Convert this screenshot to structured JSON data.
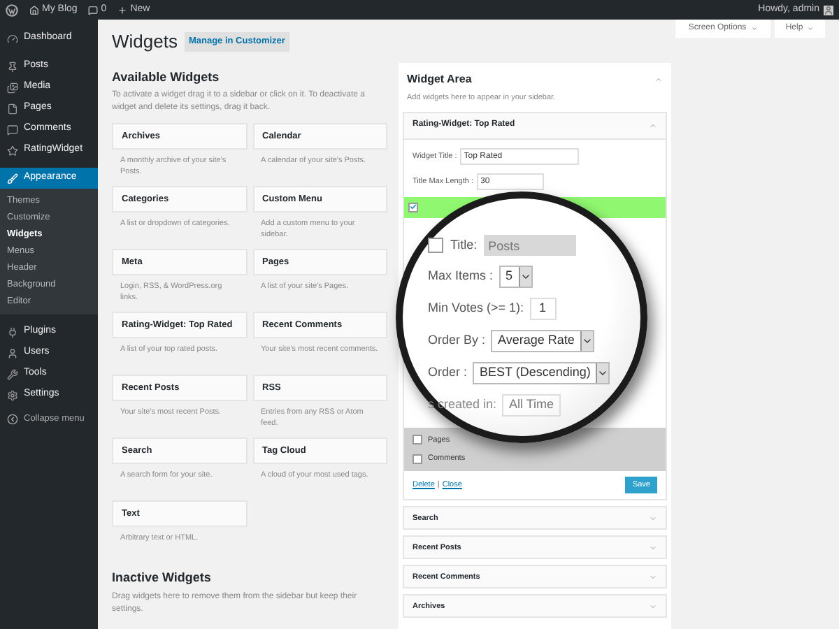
{
  "admin_bar": {
    "site": "My Blog",
    "comments": "0",
    "new": "New",
    "greeting": "Howdy, admin"
  },
  "sidebar": {
    "items": [
      {
        "label": "Dashboard",
        "selected": false
      },
      {
        "label": "Posts",
        "selected": false
      },
      {
        "label": "Media",
        "selected": false
      },
      {
        "label": "Pages",
        "selected": false
      },
      {
        "label": "Comments",
        "selected": false
      },
      {
        "label": "RatingWidget",
        "selected": false
      },
      {
        "label": "Appearance",
        "selected": true,
        "children": [
          {
            "label": "Themes",
            "selected": false
          },
          {
            "label": "Customize",
            "selected": false
          },
          {
            "label": "Widgets",
            "selected": true
          },
          {
            "label": "Menus",
            "selected": false
          },
          {
            "label": "Header",
            "selected": false
          },
          {
            "label": "Background",
            "selected": false
          },
          {
            "label": "Editor",
            "selected": false
          }
        ]
      },
      {
        "label": "Plugins",
        "selected": false
      },
      {
        "label": "Users",
        "selected": false
      },
      {
        "label": "Tools",
        "selected": false
      },
      {
        "label": "Settings",
        "selected": false
      }
    ],
    "collapse": "Collapse menu"
  },
  "page": {
    "title": "Widgets",
    "customizer_button": "Manage in Customizer",
    "screen_options": "Screen Options",
    "help": "Help"
  },
  "available": {
    "title": "Available Widgets",
    "description": "To activate a widget drag it to a sidebar or click on it. To deactivate a widget and delete its settings, drag it back.",
    "widgets": [
      {
        "title": "Archives",
        "description": "A monthly archive of your site's Posts."
      },
      {
        "title": "Calendar",
        "description": "A calendar of your site's Posts."
      },
      {
        "title": "Categories",
        "description": "A list or dropdown of categories."
      },
      {
        "title": "Custom Menu",
        "description": "Add a custom menu to your sidebar."
      },
      {
        "title": "Meta",
        "description": "Login, RSS, & WordPress.org links."
      },
      {
        "title": "Pages",
        "description": "A list of your site's Pages."
      },
      {
        "title": "Rating-Widget: Top Rated",
        "description": "A list of your top rated posts."
      },
      {
        "title": "Recent Comments",
        "description": "Your site's most recent comments."
      },
      {
        "title": "Recent Posts",
        "description": "Your site's most recent Posts."
      },
      {
        "title": "RSS",
        "description": "Entries from any RSS or Atom feed."
      },
      {
        "title": "Search",
        "description": "A search form for your site."
      },
      {
        "title": "Tag Cloud",
        "description": "A cloud of your most used tags."
      },
      {
        "title": "Text",
        "description": "Arbitrary text or HTML."
      }
    ]
  },
  "inactive": {
    "title": "Inactive Widgets",
    "description": "Drag widgets here to remove them from the sidebar but keep their settings."
  },
  "widget_area": {
    "title": "Widget Area",
    "description": "Add widgets here to appear in your sidebar.",
    "expanded": {
      "title": "Rating-Widget: Top Rated",
      "fields": [
        {
          "label": "Widget Title :",
          "value": "Top Rated"
        },
        {
          "label": "Title Max Length :",
          "value": "30"
        }
      ],
      "highlight_checked": true,
      "checkboxes": [
        {
          "label": "Pages",
          "checked": false
        },
        {
          "label": "Comments",
          "checked": false
        }
      ],
      "delete": "Delete",
      "separator": "|",
      "close": "Close",
      "save": "Save"
    },
    "collapsed": [
      "Search",
      "Recent Posts",
      "Recent Comments",
      "Archives"
    ]
  },
  "magnifier": {
    "title_row": {
      "label": "Title:",
      "checked": false,
      "placeholder": "Posts"
    },
    "fields": [
      {
        "kind": "select",
        "label": "Max Items :",
        "value": "5"
      },
      {
        "kind": "input",
        "label": "Min Votes (>= 1):",
        "value": "1"
      },
      {
        "kind": "select",
        "label": "Order By :",
        "value": "Average Rate"
      },
      {
        "kind": "select",
        "label": "Order :",
        "value": "BEST (Descending)"
      },
      {
        "kind": "faded",
        "label": "s created in:",
        "value": "All Time"
      }
    ]
  }
}
